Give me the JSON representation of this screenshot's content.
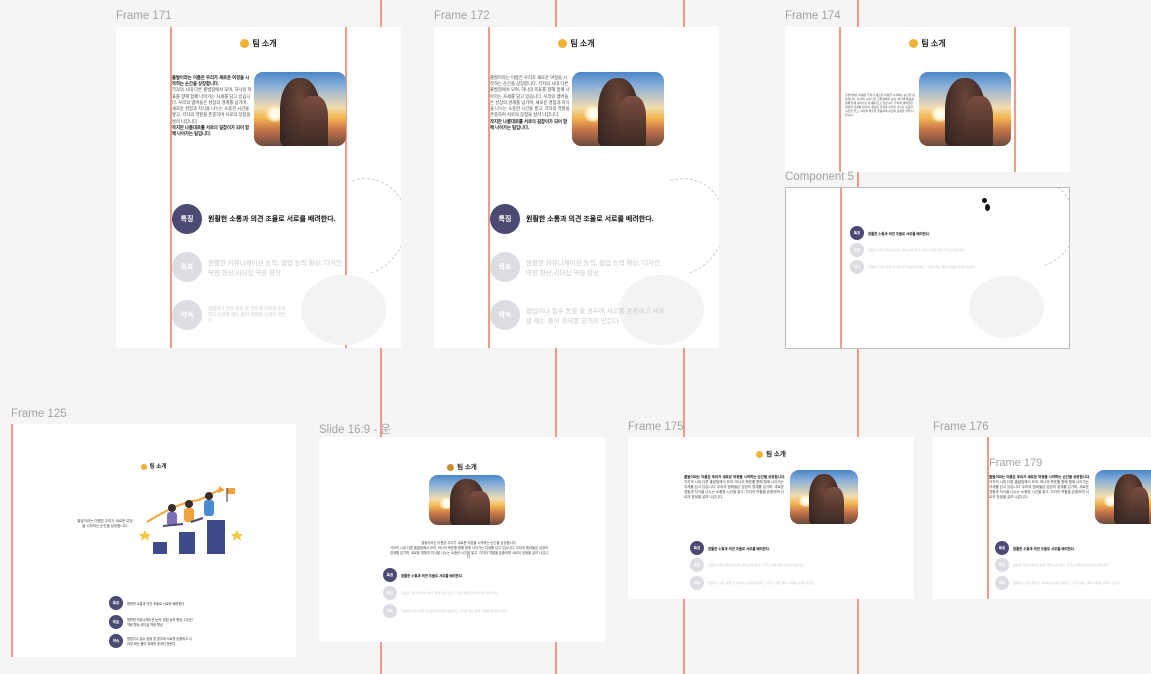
{
  "canvas": {
    "frames": {
      "f171": {
        "label": "Frame 171"
      },
      "f172": {
        "label": "Frame 172"
      },
      "f174": {
        "label": "Frame 174"
      },
      "comp5": {
        "label": "Component 5"
      },
      "f125": {
        "label": "Frame 125"
      },
      "slide": {
        "label": "Slide 16:9 - 운"
      },
      "f175": {
        "label": "Frame 175"
      },
      "f176": {
        "label": "Frame 176"
      },
      "f179": {
        "label": "Frame 179"
      }
    }
  },
  "content": {
    "title": "팀 소개",
    "intro": {
      "lead": "출발이라는 이름은 우리가 새로운 여정을 시작하는 순간을 상징합니다.",
      "body": "각자의 시대 다른 출발점에서 모여, 하나의 목표를 향해 함께 나아가는 자세를 담고 있습니다. 우리의 멤버들은 성장의 경계를 넘기며, 새로운 경험과 지식을 나누는 소중한 시간을 쌓고, 각자의 역할을 존중하며 서로의 장점을 살려 나갑니다.",
      "tail": "작지만 나름대로를 서로의 길잡이가 되어 함께 나아가는 팀입니다."
    },
    "rows": [
      {
        "badge": "특징",
        "text": "원활한 소통과 의견 조율로 서로를 배려한다.",
        "active": true
      },
      {
        "badge": "목표",
        "text": "원활한 커뮤니케이션 능력, 협업 능력 향상, 디자인 역량 향상,리더십 역량 향상",
        "active": false
      },
      {
        "badge": "약속",
        "text": "협업이나 일수 등을 할 경우에 서로를 존중하고 사과할 때는 풀어 과제를 공개지 만든다",
        "active": false
      }
    ],
    "f125_intro": "출발이라는 이름은 우리가 새로운 여정을 시작하는 순간을 상징합니다."
  },
  "colors": {
    "active": "#4a4a72",
    "inactive": "#dcdce3",
    "guide": "#f08a75"
  }
}
